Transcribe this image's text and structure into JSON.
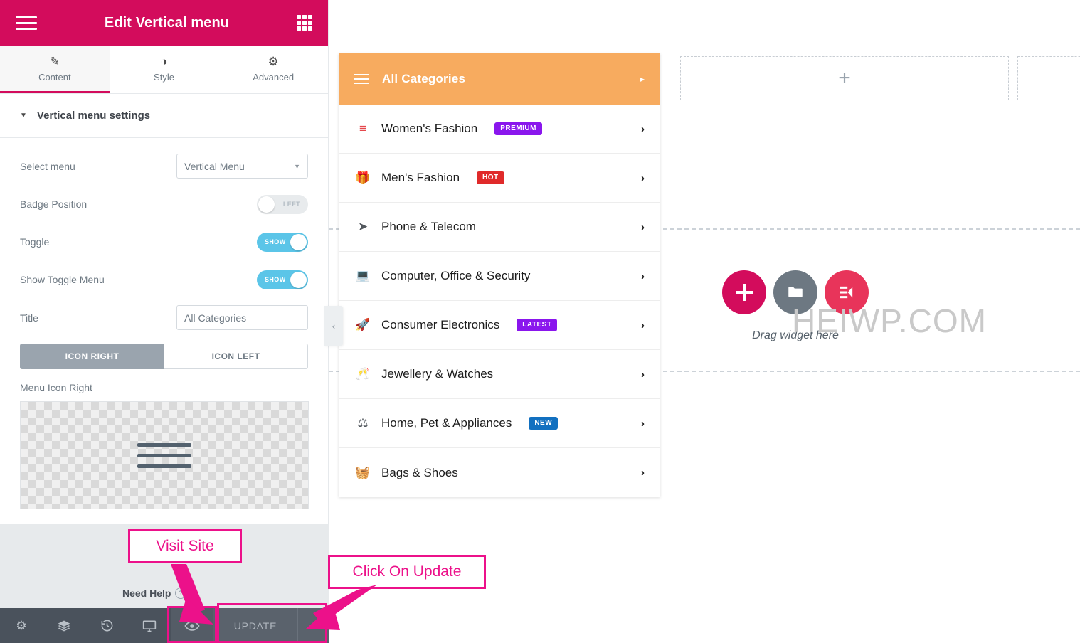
{
  "panel": {
    "header": {
      "title": "Edit Vertical menu",
      "menu_icon": "hamburger-icon",
      "grid_icon": "grid-apps-icon"
    },
    "tabs": [
      {
        "label": "Content",
        "icon": "pencil-icon",
        "active": true
      },
      {
        "label": "Style",
        "icon": "contrast-circle-icon",
        "active": false
      },
      {
        "label": "Advanced",
        "icon": "gear-icon",
        "active": false
      }
    ],
    "section": {
      "title": "Vertical menu settings",
      "caret": "▼"
    },
    "controls": {
      "select_menu": {
        "label": "Select menu",
        "value": "Vertical Menu"
      },
      "badge_position": {
        "label": "Badge Position",
        "state": "LEFT",
        "on": false
      },
      "toggle": {
        "label": "Toggle",
        "state": "SHOW",
        "on": true
      },
      "show_toggle_menu": {
        "label": "Show Toggle Menu",
        "state": "SHOW",
        "on": true
      },
      "title": {
        "label": "Title",
        "value": "All Categories",
        "placeholder": "All Categories"
      },
      "icon_side": {
        "right_label": "ICON RIGHT",
        "left_label": "ICON LEFT",
        "selected": "ICON RIGHT"
      },
      "menu_icon_right": {
        "label": "Menu Icon Right",
        "image": "hamburger-icon-transparent"
      }
    },
    "footer": {
      "need_help": "Need Help"
    },
    "bottom_bar": {
      "settings_icon": "gear-icon",
      "navigator_icon": "layers-icon",
      "history_icon": "history-revert-icon",
      "responsive_icon": "monitor-icon",
      "preview_icon": "eye-icon",
      "update_label": "UPDATE",
      "update_caret": "▲"
    },
    "collapse_handle": "‹"
  },
  "canvas": {
    "vertical_menu": {
      "header": {
        "title": "All Categories",
        "icon": "hamburger-icon",
        "arrow": "▸"
      },
      "items": [
        {
          "label": "Women's Fashion",
          "icon": "red-lines-icon",
          "icon_glyph": "≡",
          "badge": "PREMIUM",
          "badge_color": "#8a16ed",
          "arrow": "›"
        },
        {
          "label": "Men's Fashion",
          "icon": "gift-icon",
          "icon_glyph": "🎁",
          "badge": "HOT",
          "badge_color": "#e02a2a",
          "arrow": "›"
        },
        {
          "label": "Phone & Telecom",
          "icon": "paper-plane-icon",
          "icon_glyph": "➤",
          "badge": "",
          "badge_color": "",
          "arrow": "›"
        },
        {
          "label": "Computer, Office & Security",
          "icon": "laptop-icon",
          "icon_glyph": "💻",
          "badge": "",
          "badge_color": "",
          "arrow": "›"
        },
        {
          "label": "Consumer Electronics",
          "icon": "rocket-icon",
          "icon_glyph": "🚀",
          "badge": "LATEST",
          "badge_color": "#8a16ed",
          "arrow": "›"
        },
        {
          "label": "Jewellery & Watches",
          "icon": "cheers-glasses-icon",
          "icon_glyph": "🥂",
          "badge": "",
          "badge_color": "",
          "arrow": "›"
        },
        {
          "label": "Home, Pet & Appliances",
          "icon": "scales-balance-icon",
          "icon_glyph": "⚖",
          "badge": "NEW",
          "badge_color": "#1270c0",
          "arrow": "›"
        },
        {
          "label": "Bags & Shoes",
          "icon": "basket-icon",
          "icon_glyph": "🧺",
          "badge": "",
          "badge_color": "",
          "arrow": "›"
        }
      ]
    },
    "watermark": "HEIWP.COM",
    "placeholder_plus": "+",
    "drop_area": {
      "text": "Drag widget here",
      "add_button": "add-section-icon",
      "template_button": "folder-template-icon",
      "elementor_button": "elementor-logo-icon"
    }
  },
  "annotations": {
    "visit_site": "Visit Site",
    "click_update": "Click On Update"
  },
  "colors": {
    "brand_pink": "#d30c5c",
    "annotation_pink": "#ec118a",
    "menu_header_orange": "#f7ab5f",
    "toggle_on": "#5bc5e8",
    "toolbar_dark": "#4a525c"
  }
}
